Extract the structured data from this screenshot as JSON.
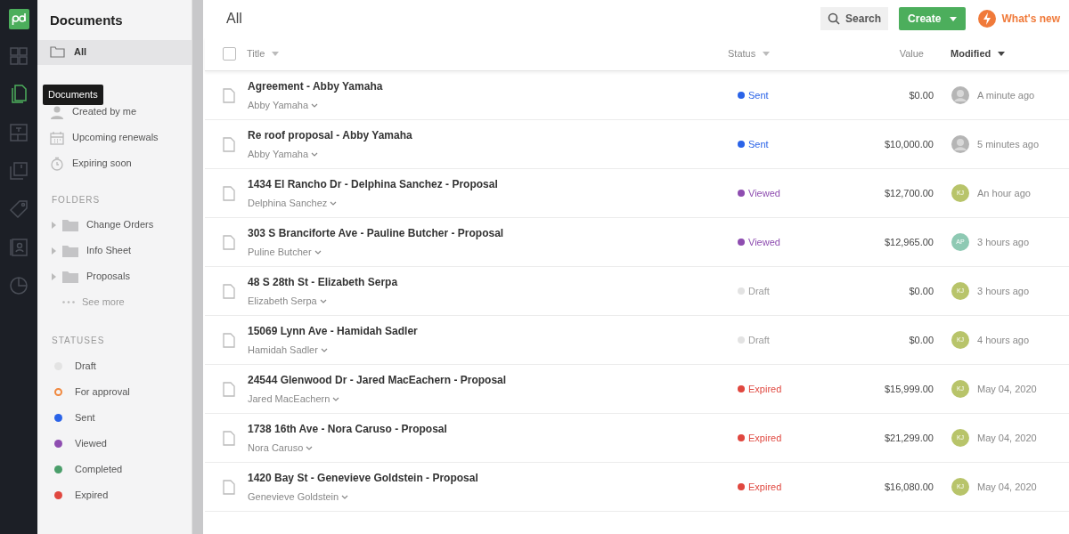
{
  "rail": {
    "items": [
      {
        "kind": "grid",
        "selected": false
      },
      {
        "kind": "documents",
        "selected": true
      },
      {
        "kind": "template",
        "selected": false
      },
      {
        "kind": "catalog",
        "selected": false
      },
      {
        "kind": "tag",
        "selected": false
      },
      {
        "kind": "contacts",
        "selected": false
      },
      {
        "kind": "chart",
        "selected": false
      }
    ],
    "tooltip": "Documents"
  },
  "sidebar": {
    "title": "Documents",
    "all": {
      "label": "All",
      "selected": true
    },
    "filters": [
      {
        "kind": "person",
        "label": "Created by me"
      },
      {
        "kind": "calendar",
        "label": "Upcoming renewals"
      },
      {
        "kind": "timer",
        "label": "Expiring soon"
      }
    ],
    "folders_heading": "FOLDERS",
    "folders": [
      {
        "label": "Change Orders",
        "expanded": false
      },
      {
        "label": "Info Sheet",
        "expanded": false
      },
      {
        "label": "Proposals",
        "expanded": false
      }
    ],
    "see_more": "See more",
    "statuses_heading": "STATUSES",
    "statuses": [
      {
        "label": "Draft",
        "color": "#e3e3e3",
        "kind": "dot"
      },
      {
        "label": "For approval",
        "color": "#f0883e",
        "kind": "ring"
      },
      {
        "label": "Sent",
        "color": "#2a63e8",
        "kind": "dot"
      },
      {
        "label": "Viewed",
        "color": "#8e4db0",
        "kind": "dot"
      },
      {
        "label": "Completed",
        "color": "#4a9e6a",
        "kind": "dot"
      },
      {
        "label": "Expired",
        "color": "#e0473f",
        "kind": "dot"
      }
    ]
  },
  "header": {
    "title": "All",
    "search": "Search",
    "create": "Create",
    "whats_new": "What's new"
  },
  "table": {
    "select_all": {
      "checked": false
    },
    "columns": [
      {
        "label": "Title",
        "sorted": false
      },
      {
        "label": "Status",
        "sorted": false
      },
      {
        "label": "Value",
        "sorted": false
      },
      {
        "label": "Modified",
        "sorted": true
      }
    ],
    "rows": [
      {
        "title": "Agreement - Abby Yamaha",
        "owner": "Abby Yamaha",
        "status": "Sent",
        "color": "#2a63e8",
        "value": "$0.00",
        "avatar": {
          "kind": "photo"
        },
        "modified": "A minute ago"
      },
      {
        "title": "Re roof proposal - Abby Yamaha",
        "owner": "Abby Yamaha",
        "status": "Sent",
        "color": "#2a63e8",
        "value": "$10,000.00",
        "avatar": {
          "kind": "photo"
        },
        "modified": "5 minutes ago"
      },
      {
        "title": "1434 El Rancho Dr - Delphina Sanchez - Proposal",
        "owner": "Delphina Sanchez",
        "status": "Viewed",
        "color": "#8e4db0",
        "value": "$12,700.00",
        "avatar": {
          "kind": "initials",
          "text": "KJ",
          "color": "#b8c46a"
        },
        "modified": "An hour ago"
      },
      {
        "title": "303 S Branciforte Ave - Pauline Butcher - Proposal",
        "owner": "Puline Butcher",
        "status": "Viewed",
        "color": "#8e4db0",
        "value": "$12,965.00",
        "avatar": {
          "kind": "initials",
          "text": "AP",
          "color": "#8ec9b3"
        },
        "modified": "3 hours ago"
      },
      {
        "title": "48 S 28th St - Elizabeth Serpa",
        "owner": "Elizabeth Serpa",
        "status": "Draft",
        "color": "#e3e3e3",
        "value": "$0.00",
        "avatar": {
          "kind": "initials",
          "text": "KJ",
          "color": "#b8c46a"
        },
        "modified": "3 hours ago"
      },
      {
        "title": "15069 Lynn Ave - Hamidah Sadler",
        "owner": "Hamidah Sadler",
        "status": "Draft",
        "color": "#e3e3e3",
        "value": "$0.00",
        "avatar": {
          "kind": "initials",
          "text": "KJ",
          "color": "#b8c46a"
        },
        "modified": "4 hours ago"
      },
      {
        "title": "24544 Glenwood Dr - Jared MacEachern - Proposal",
        "owner": "Jared MacEachern",
        "status": "Expired",
        "color": "#e0473f",
        "value": "$15,999.00",
        "avatar": {
          "kind": "initials",
          "text": "KJ",
          "color": "#b8c46a"
        },
        "modified": "May 04, 2020"
      },
      {
        "title": "1738 16th Ave - Nora Caruso - Proposal",
        "owner": "Nora Caruso",
        "status": "Expired",
        "color": "#e0473f",
        "value": "$21,299.00",
        "avatar": {
          "kind": "initials",
          "text": "KJ",
          "color": "#b8c46a"
        },
        "modified": "May 04, 2020"
      },
      {
        "title": "1420 Bay St - Genevieve Goldstein - Proposal",
        "owner": "Genevieve Goldstein",
        "status": "Expired",
        "color": "#e0473f",
        "value": "$16,080.00",
        "avatar": {
          "kind": "initials",
          "text": "KJ",
          "color": "#b8c46a"
        },
        "modified": "May 04, 2020"
      }
    ]
  }
}
